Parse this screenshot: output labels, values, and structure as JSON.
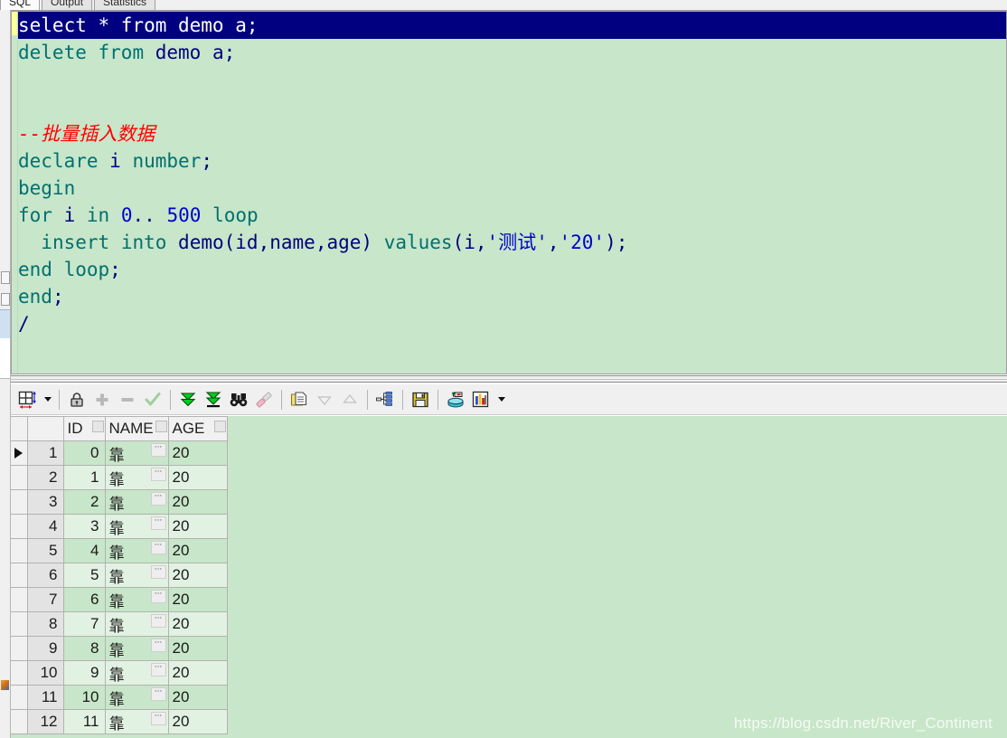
{
  "tabs": [
    {
      "label": "SQL",
      "active": true
    },
    {
      "label": "Output",
      "active": false
    },
    {
      "label": "Statistics",
      "active": false
    }
  ],
  "editor": {
    "lines": [
      {
        "id": 0,
        "text": "select * from demo a;",
        "selected": true
      },
      {
        "id": 1,
        "text": "delete from demo a;",
        "selected": false
      },
      {
        "id": 2,
        "text": "",
        "selected": false
      },
      {
        "id": 3,
        "text": "",
        "selected": false
      },
      {
        "id": 4,
        "text": "--批量插入数据",
        "selected": false
      },
      {
        "id": 5,
        "text": "declare i number;",
        "selected": false
      },
      {
        "id": 6,
        "text": "begin",
        "selected": false
      },
      {
        "id": 7,
        "text": "for i in 0.. 500 loop",
        "selected": false
      },
      {
        "id": 8,
        "text": "  insert into demo(id,name,age) values(i,'测试','20');",
        "selected": false
      },
      {
        "id": 9,
        "text": "end loop;",
        "selected": false
      },
      {
        "id": 10,
        "text": "end;",
        "selected": false
      },
      {
        "id": 11,
        "text": "/",
        "selected": false
      }
    ],
    "selection_bg": "#000080",
    "background": "#c8e6c9",
    "keyword_color": "#007070",
    "literal_color": "#0000cc",
    "comment_color": "#ff0000",
    "gutter_marker_color": "#ffff99"
  },
  "toolbar": {
    "items": [
      {
        "name": "grid-layout-button",
        "title": "Grid layout",
        "interactable": true
      },
      {
        "name": "grid-layout-dropdown",
        "title": "Grid layout options",
        "interactable": true
      },
      {
        "name": "lock-record-button",
        "title": "Lock record",
        "interactable": true
      },
      {
        "name": "insert-row-button",
        "title": "Insert row",
        "interactable": true
      },
      {
        "name": "delete-row-button",
        "title": "Delete row",
        "interactable": true
      },
      {
        "name": "post-changes-button",
        "title": "Post changes",
        "interactable": true
      },
      {
        "name": "fetch-next-page-button",
        "title": "Fetch next page",
        "interactable": true
      },
      {
        "name": "fetch-last-page-button",
        "title": "Fetch last page",
        "interactable": true
      },
      {
        "name": "find-button",
        "title": "Find",
        "interactable": true
      },
      {
        "name": "clear-filter-button",
        "title": "Clear",
        "interactable": true
      },
      {
        "name": "copy-to-clipboard-button",
        "title": "Copy to clipboard",
        "interactable": true
      },
      {
        "name": "sort-descending-button",
        "title": "Sort descending",
        "interactable": true
      },
      {
        "name": "sort-ascending-button",
        "title": "Sort ascending",
        "interactable": true
      },
      {
        "name": "explain-plan-button",
        "title": "Explain plan",
        "interactable": true
      },
      {
        "name": "save-button",
        "title": "Save",
        "interactable": true
      },
      {
        "name": "export-data-button",
        "title": "Export data",
        "interactable": true
      },
      {
        "name": "chart-button",
        "title": "Chart",
        "interactable": true
      },
      {
        "name": "chart-dropdown",
        "title": "Chart options",
        "interactable": true
      }
    ]
  },
  "grid": {
    "columns": [
      "ID",
      "NAME",
      "AGE"
    ],
    "rows": [
      {
        "rownum": "1",
        "ID": "0",
        "NAME": "靠",
        "AGE": "20",
        "current": true
      },
      {
        "rownum": "2",
        "ID": "1",
        "NAME": "靠",
        "AGE": "20",
        "current": false
      },
      {
        "rownum": "3",
        "ID": "2",
        "NAME": "靠",
        "AGE": "20",
        "current": false
      },
      {
        "rownum": "4",
        "ID": "3",
        "NAME": "靠",
        "AGE": "20",
        "current": false
      },
      {
        "rownum": "5",
        "ID": "4",
        "NAME": "靠",
        "AGE": "20",
        "current": false
      },
      {
        "rownum": "6",
        "ID": "5",
        "NAME": "靠",
        "AGE": "20",
        "current": false
      },
      {
        "rownum": "7",
        "ID": "6",
        "NAME": "靠",
        "AGE": "20",
        "current": false
      },
      {
        "rownum": "8",
        "ID": "7",
        "NAME": "靠",
        "AGE": "20",
        "current": false
      },
      {
        "rownum": "9",
        "ID": "8",
        "NAME": "靠",
        "AGE": "20",
        "current": false
      },
      {
        "rownum": "10",
        "ID": "9",
        "NAME": "靠",
        "AGE": "20",
        "current": false
      },
      {
        "rownum": "11",
        "ID": "10",
        "NAME": "靠",
        "AGE": "20",
        "current": false
      },
      {
        "rownum": "12",
        "ID": "11",
        "NAME": "靠",
        "AGE": "20",
        "current": false
      }
    ],
    "ellipsis_label": "···"
  },
  "watermark": {
    "text": "https://blog.csdn.net/River_Continent"
  }
}
